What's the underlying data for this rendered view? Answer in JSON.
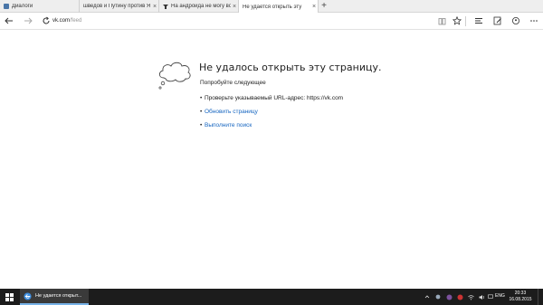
{
  "browser": {
    "tabs": [
      {
        "label": "Диалоги",
        "active": false
      },
      {
        "label": "шведов и Путину против Я",
        "active": false
      },
      {
        "label": "На андроида не могу войти",
        "active": false
      },
      {
        "label": "Не удается открыть эту",
        "active": true
      }
    ],
    "new_tab_label": "+",
    "address": {
      "host": "vk.com",
      "path": "/feed"
    }
  },
  "error_page": {
    "title": "Не удалось открыть эту страницу.",
    "subtitle": "Попробуйте следующее",
    "items": [
      {
        "text": "Проверьте указываемый URL-адрес: https://vk.com",
        "link": false
      },
      {
        "text": "Обновить страницу",
        "link": true
      },
      {
        "text": "Выполните поиск",
        "link": true
      }
    ]
  },
  "taskbar": {
    "app_label": "Не удается открыт...",
    "lang": "ENG",
    "time": "20:33",
    "date": "16.08.2015"
  },
  "colors": {
    "link": "#1565c0",
    "taskbar": "#1c1c1c",
    "tab_strip": "#eeeeee"
  }
}
